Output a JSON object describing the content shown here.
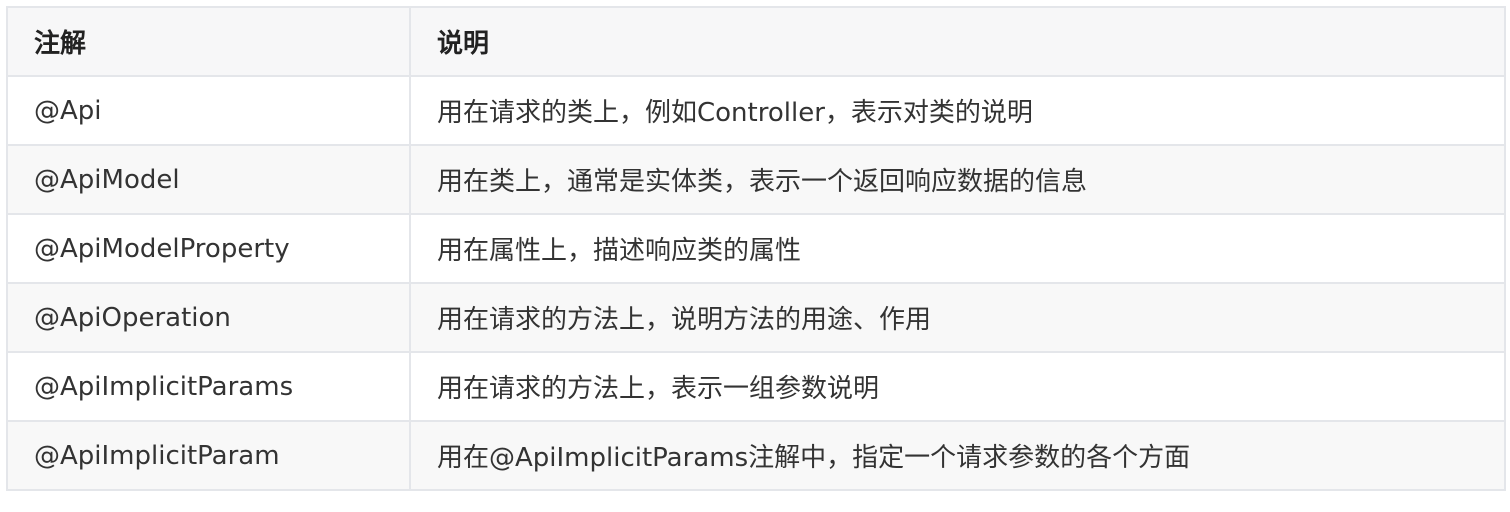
{
  "header": {
    "col1": "注解",
    "col2": "说明"
  },
  "rows": [
    {
      "annotation": "@Api",
      "description": "用在请求的类上，例如Controller，表示对类的说明"
    },
    {
      "annotation": "@ApiModel",
      "description": "用在类上，通常是实体类，表示一个返回响应数据的信息"
    },
    {
      "annotation": "@ApiModelProperty",
      "description": "用在属性上，描述响应类的属性"
    },
    {
      "annotation": "@ApiOperation",
      "description": "用在请求的方法上，说明方法的用途、作用"
    },
    {
      "annotation": "@ApiImplicitParams",
      "description": "用在请求的方法上，表示一组参数说明"
    },
    {
      "annotation": "@ApiImplicitParam",
      "description": "用在@ApiImplicitParams注解中，指定一个请求参数的各个方面"
    }
  ]
}
